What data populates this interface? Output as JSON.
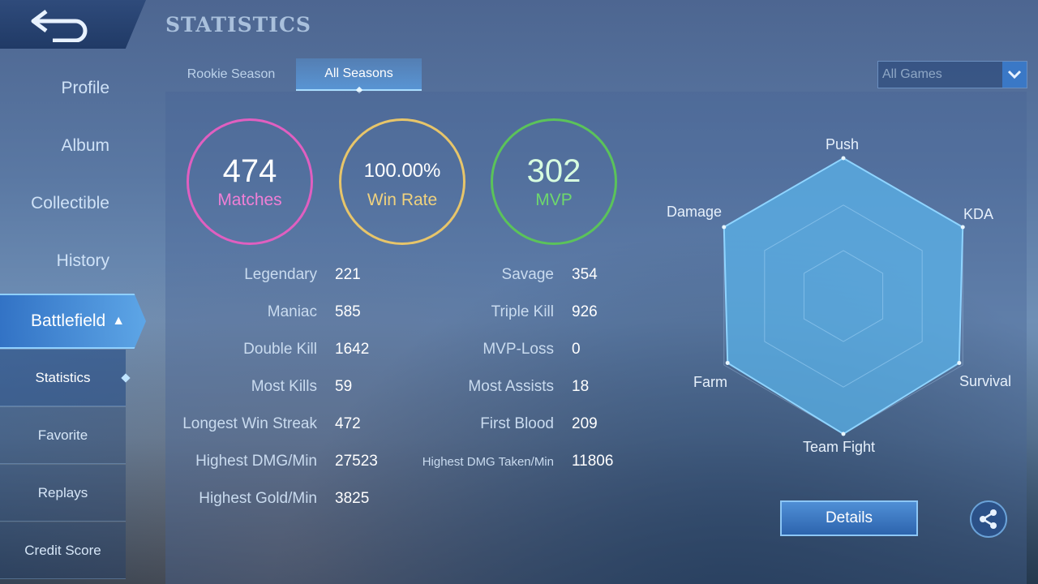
{
  "header": {
    "title": "STATISTICS"
  },
  "sidebar": {
    "items": [
      {
        "label": "Profile"
      },
      {
        "label": "Album"
      },
      {
        "label": "Collectible"
      },
      {
        "label": "History"
      },
      {
        "label": "Battlefield"
      }
    ],
    "sub_items": [
      {
        "label": "Statistics"
      },
      {
        "label": "Favorite"
      },
      {
        "label": "Replays"
      },
      {
        "label": "Credit Score"
      }
    ]
  },
  "tabs": [
    {
      "label": "Rookie Season"
    },
    {
      "label": "All Seasons"
    }
  ],
  "filter": {
    "selected": "All Games"
  },
  "summary": {
    "matches": {
      "value": "474",
      "label": "Matches",
      "color": "#e05fc0"
    },
    "win_rate": {
      "value": "100.00%",
      "label": "Win Rate",
      "color": "#e7c56a"
    },
    "mvp": {
      "value": "302",
      "label": "MVP",
      "color": "#5bc35a"
    }
  },
  "stats_left": [
    {
      "label": "Legendary",
      "value": "221"
    },
    {
      "label": "Maniac",
      "value": "585"
    },
    {
      "label": "Double Kill",
      "value": "1642"
    },
    {
      "label": "Most Kills",
      "value": "59"
    },
    {
      "label": "Longest Win Streak",
      "value": "472"
    },
    {
      "label": "Highest DMG/Min",
      "value": "27523"
    },
    {
      "label": "Highest Gold/Min",
      "value": "3825"
    }
  ],
  "stats_right": [
    {
      "label": "Savage",
      "value": "354"
    },
    {
      "label": "Triple Kill",
      "value": "926"
    },
    {
      "label": "MVP-Loss",
      "value": "0"
    },
    {
      "label": "Most Assists",
      "value": "18"
    },
    {
      "label": "First Blood",
      "value": "209"
    },
    {
      "label": "Highest DMG Taken/Min",
      "value": "11806"
    }
  ],
  "radar": {
    "labels": [
      "Push",
      "KDA",
      "Survival",
      "Team Fight",
      "Farm",
      "Damage"
    ],
    "values": [
      1.0,
      1.0,
      0.97,
      1.0,
      0.97,
      1.0
    ]
  },
  "actions": {
    "details": "Details"
  },
  "icons": {
    "back": "back-arrow-icon",
    "share": "share-icon",
    "dropdown": "chevron-down-icon"
  }
}
